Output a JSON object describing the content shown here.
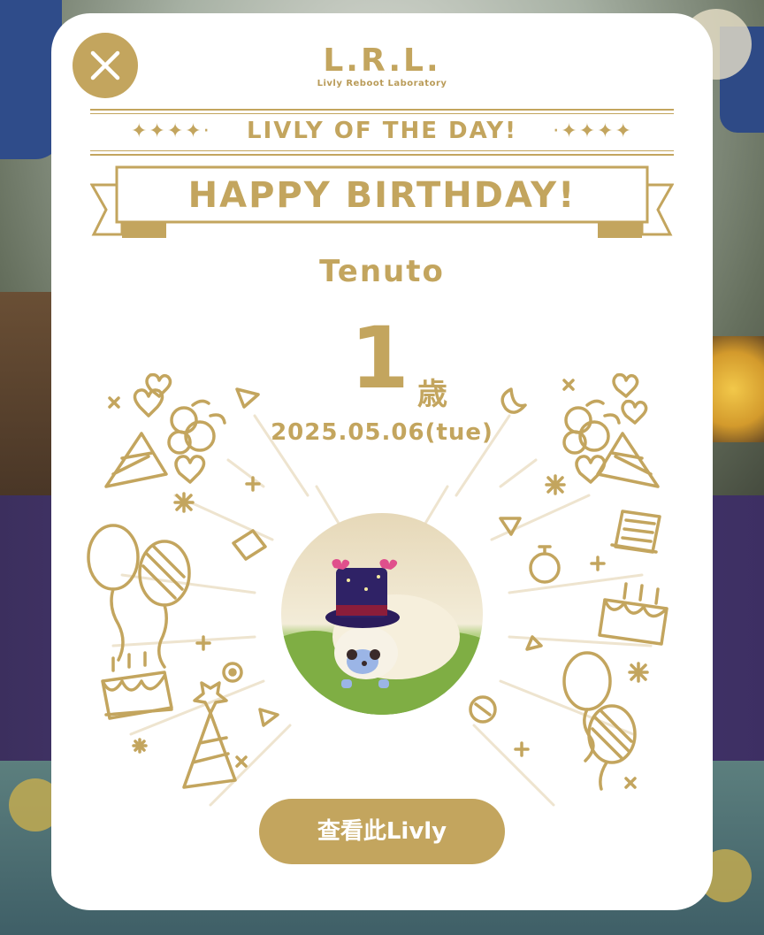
{
  "logo": {
    "title": "L.R.L.",
    "subtitle": "Livly Reboot Laboratory"
  },
  "header": {
    "livly_of_the_day": "LIVLY OF THE DAY!",
    "stars_left": "✦✦✦✦·",
    "stars_right": "·✦✦✦✦"
  },
  "banner": {
    "title": "HAPPY BIRTHDAY!"
  },
  "livly": {
    "name": "Tenuto",
    "age": "1",
    "age_unit": "歳",
    "date": "2025.05.06(tue)"
  },
  "buttons": {
    "view_livly": "查看此Livly"
  },
  "icons": {
    "close": "close-icon"
  },
  "colors": {
    "accent": "#c3a55e",
    "panel": "#ffffff"
  }
}
